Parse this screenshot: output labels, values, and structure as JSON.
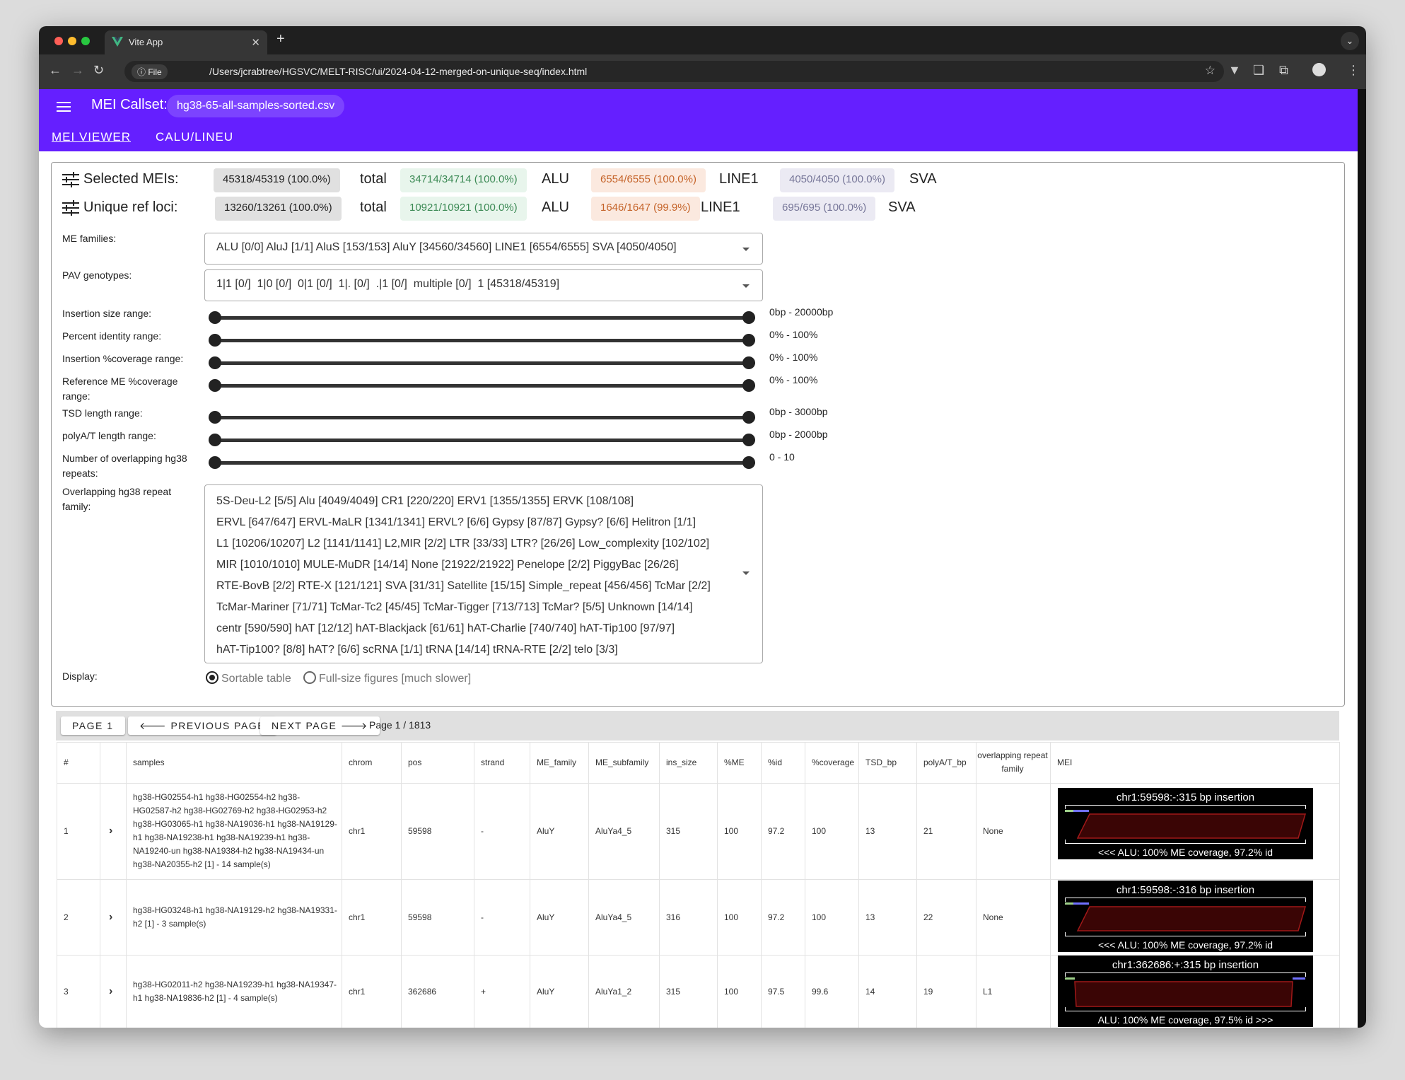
{
  "browser": {
    "tab_title": "Vite App",
    "url_badge": "File",
    "url": "/Users/jcrabtree/HGSVC/MELT-RISC/ui/2024-04-12-merged-on-unique-seq/index.html"
  },
  "app": {
    "callset_label": "MEI Callset:",
    "callset_value": "hg38-65-all-samples-sorted.csv",
    "tabs": [
      "MEI VIEWER",
      "CALU/LINEU"
    ]
  },
  "summary": {
    "selected": {
      "label": "Selected MEIs:",
      "total": "45318/45319 (100.0%)",
      "total_word": "total",
      "alu": "34714/34714 (100.0%)",
      "alu_word": "ALU",
      "line1": "6554/6555 (100.0%)",
      "line1_word": "LINE1",
      "sva": "4050/4050 (100.0%)",
      "sva_word": "SVA"
    },
    "unique": {
      "label": "Unique ref loci:",
      "total": "13260/13261 (100.0%)",
      "total_word": "total",
      "alu": "10921/10921 (100.0%)",
      "alu_word": "ALU",
      "line1": "1646/1647 (99.9%)",
      "line1_word": "LINE1",
      "sva": "695/695 (100.0%)",
      "sva_word": "SVA"
    },
    "colors": {
      "total_bg": "#e0e0e0",
      "alu_bg": "#e8f5ec",
      "alu_fg": "#3c8a55",
      "line1_bg": "#fbe9df",
      "line1_fg": "#c5642a",
      "sva_bg": "#ebeaf3",
      "sva_fg": "#777799"
    }
  },
  "filters": {
    "me_families_label": "ME families:",
    "me_families_value": "ALU [0/0] AluJ [1/1] AluS [153/153] AluY [34560/34560] LINE1 [6554/6555] SVA [4050/4050]",
    "pav_label": "PAV genotypes:",
    "pav_value": "1|1 [0/]  1|0 [0/]  0|1 [0/]  1|. [0/]  .|1 [0/]  multiple [0/]  1 [45318/45319]",
    "ranges": [
      {
        "label": "Insertion size range:",
        "value": "0bp - 20000bp"
      },
      {
        "label": "Percent identity range:",
        "value": "0% - 100%"
      },
      {
        "label": "Insertion %coverage range:",
        "value": "0% - 100%"
      },
      {
        "label": "Reference ME %coverage range:",
        "value": "0% - 100%"
      },
      {
        "label": "TSD length range:",
        "value": "0bp - 3000bp"
      },
      {
        "label": "polyA/T length range:",
        "value": "0bp - 2000bp"
      },
      {
        "label": "Number of overlapping hg38 repeats:",
        "value": "0 - 10"
      }
    ],
    "repeat_label": "Overlapping hg38 repeat family:",
    "repeat_lines": [
      "5S-Deu-L2 [5/5] Alu [4049/4049] CR1 [220/220] ERV1 [1355/1355] ERVK [108/108]",
      "ERVL [647/647] ERVL-MaLR [1341/1341] ERVL? [6/6] Gypsy [87/87] Gypsy? [6/6] Helitron [1/1]",
      "L1 [10206/10207] L2 [1141/1141] L2,MIR [2/2] LTR [33/33] LTR? [26/26] Low_complexity [102/102]",
      "MIR [1010/1010] MULE-MuDR [14/14] None [21922/21922] Penelope [2/2] PiggyBac [26/26]",
      "RTE-BovB [2/2] RTE-X [121/121] SVA [31/31] Satellite [15/15] Simple_repeat [456/456] TcMar [2/2]",
      "TcMar-Mariner [71/71] TcMar-Tc2 [45/45] TcMar-Tigger [713/713] TcMar? [5/5] Unknown [14/14]",
      "centr [590/590] hAT [12/12] hAT-Blackjack [61/61] hAT-Charlie [740/740] hAT-Tip100 [97/97]",
      "hAT-Tip100? [8/8] hAT? [6/6] scRNA [1/1] tRNA [14/14] tRNA-RTE [2/2] telo [3/3]"
    ],
    "display_label": "Display:",
    "display_opt1": "Sortable table",
    "display_opt2": "Full-size figures [much slower]"
  },
  "pager": {
    "page1": "PAGE 1",
    "prev": "PREVIOUS PAGE",
    "next": "NEXT PAGE",
    "info": "Page 1 / 1813"
  },
  "table": {
    "headers": [
      "#",
      "",
      "samples",
      "chrom",
      "pos",
      "strand",
      "ME_family",
      "ME_subfamily",
      "ins_size",
      "%ME",
      "%id",
      "%coverage",
      "TSD_bp",
      "polyA/T_bp",
      "overlapping repeat family",
      "MEI"
    ],
    "rows": [
      {
        "n": "1",
        "samples": "hg38-HG02554-h1 hg38-HG02554-h2 hg38-HG02587-h2 hg38-HG02769-h2 hg38-HG02953-h2 hg38-HG03065-h1 hg38-NA19036-h1 hg38-NA19129-h1 hg38-NA19238-h1 hg38-NA19239-h1 hg38-NA19240-un hg38-NA19384-h2 hg38-NA19434-un hg38-NA20355-h2 [1] - 14 sample(s)",
        "chrom": "chr1",
        "pos": "59598",
        "strand": "-",
        "fam": "AluY",
        "sub": "AluYa4_5",
        "ins": "315",
        "me": "100",
        "id": "97.2",
        "cov": "100",
        "tsd": "13",
        "poly": "21",
        "rep": "None",
        "mei_title": "chr1:59598:-:315 bp insertion",
        "mei_caption": "<<< ALU: 100% ME coverage, 97.2% id"
      },
      {
        "n": "2",
        "samples": "hg38-HG03248-h1 hg38-NA19129-h2 hg38-NA19331-h2 [1] - 3 sample(s)",
        "chrom": "chr1",
        "pos": "59598",
        "strand": "-",
        "fam": "AluY",
        "sub": "AluYa4_5",
        "ins": "316",
        "me": "100",
        "id": "97.2",
        "cov": "100",
        "tsd": "13",
        "poly": "22",
        "rep": "None",
        "mei_title": "chr1:59598:-:316 bp insertion",
        "mei_caption": "<<< ALU: 100% ME coverage, 97.2% id"
      },
      {
        "n": "3",
        "samples": "hg38-HG02011-h2 hg38-NA19239-h1 hg38-NA19347-h1 hg38-NA19836-h2 [1] - 4 sample(s)",
        "chrom": "chr1",
        "pos": "362686",
        "strand": "+",
        "fam": "AluY",
        "sub": "AluYa1_2",
        "ins": "315",
        "me": "100",
        "id": "97.5",
        "cov": "99.6",
        "tsd": "14",
        "poly": "19",
        "rep": "L1",
        "mei_title": "chr1:362686:+:315 bp insertion",
        "mei_caption": "ALU: 100% ME coverage, 97.5% id >>>"
      }
    ]
  }
}
